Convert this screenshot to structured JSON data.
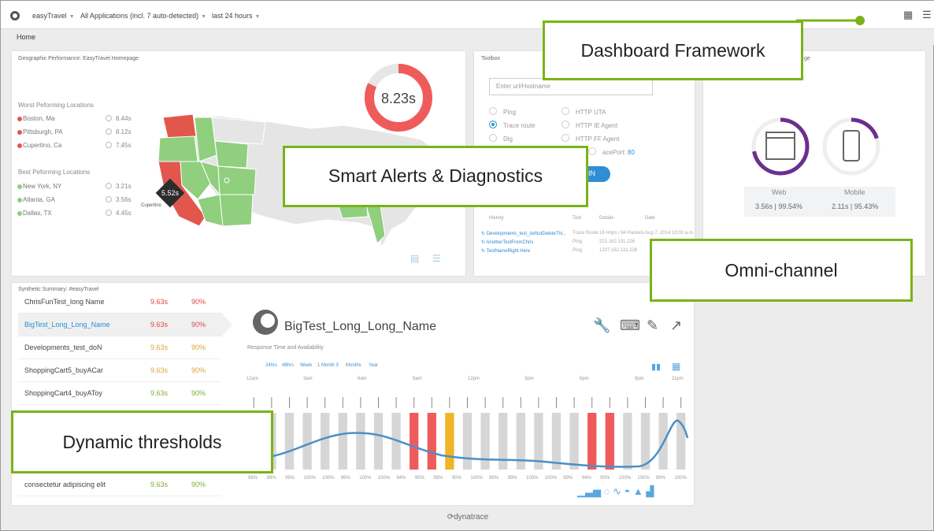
{
  "topbar": {
    "app": "easyTravel",
    "apps": "All Applications (incl. 7 auto-detected)",
    "time": "last 24 hours"
  },
  "breadcrumb": "Home",
  "geo": {
    "title": "Geographic Performance: EasyTravel Homepage",
    "score": "8.23s",
    "score_fraction": 0.82,
    "worst_heading": "Worst Peforming Locations",
    "worst": [
      {
        "name": "Boston, Ma",
        "time": "8.44s"
      },
      {
        "name": "Pittsburgh, PA",
        "time": "8.12s"
      },
      {
        "name": "Cupertino, Ca",
        "time": "7.45s"
      }
    ],
    "best_heading": "Best Peforming Locations",
    "best": [
      {
        "name": "New York, NY",
        "time": "3.21s"
      },
      {
        "name": "Atlanta, GA",
        "time": "3.56s"
      },
      {
        "name": "Dallas, TX",
        "time": "4.45s"
      }
    ],
    "tooltip_value": "5.52s",
    "tooltip_city": "Cupertino",
    "colors": {
      "bad": "#e2574c",
      "good": "#8fcf7e",
      "neutral": "#e5e5e5"
    }
  },
  "toolbox": {
    "title": "Toolbox",
    "url_placeholder": "Enter url/Hostname",
    "options": [
      "Ping",
      "Trace route",
      "Dig",
      "HTTP UTA",
      "HTTP IE Agent",
      "HTTP FF Agent"
    ],
    "selected": "Trace route",
    "port_label": "acePort:",
    "port_value": "80",
    "run_label": "IN",
    "history_headers": [
      "History",
      "Tool",
      "Details",
      "Date"
    ],
    "history": [
      {
        "name": "Developments_test_doNotDeleteThi...",
        "tool": "Trace Route",
        "details": "16 Hops / 64 Packets",
        "date": "Aug 7, 2014 10:00 a.m."
      },
      {
        "name": "AnotherTestFromChris",
        "tool": "Ping",
        "details": "221.162.131.226",
        "date": ""
      },
      {
        "name": "TestNameRight Here",
        "tool": "Ping",
        "details": "1207.162.131.226",
        "date": ""
      }
    ]
  },
  "channels": {
    "suffix": "ge",
    "web": {
      "label": "Web",
      "value": "3.56s | 99.54%",
      "fraction": 0.72
    },
    "mobile": {
      "label": "Mobile",
      "value": "2.11s | 95.43%",
      "fraction": 0.2
    }
  },
  "synthetic": {
    "title": "Synthetic Summary: #easyTravel",
    "rows": [
      {
        "name": "ChrisFunTest_long Name",
        "time": "9.63s",
        "avail": "90%",
        "status": "red"
      },
      {
        "name": "BigTest_Long_Long_Name",
        "time": "9.63s",
        "avail": "90%",
        "status": "red",
        "selected": true
      },
      {
        "name": "Developments_test_doN",
        "time": "9.63s",
        "avail": "90%",
        "status": "amber"
      },
      {
        "name": "ShoppingCart5_buyACar",
        "time": "9.63s",
        "avail": "90%",
        "status": "amber"
      },
      {
        "name": "ShoppingCart4_buyAToy",
        "time": "9.63s",
        "avail": "90%",
        "status": "green"
      },
      {
        "name": "consectetur adipiscing elit",
        "time": "9.63s",
        "avail": "90%",
        "status": "green"
      }
    ]
  },
  "detail": {
    "name": "BigTest_Long_Long_Name",
    "subtitle": "Response Time and Availability",
    "ranges": [
      "24hrs",
      "48hrs",
      "Week",
      "1 Month 3",
      "Months",
      "Year"
    ],
    "hours": [
      "12am",
      "3am",
      "6am",
      "9am",
      "12pm",
      "3pm",
      "6pm",
      "9pm",
      "11pm"
    ]
  },
  "chart_data": {
    "type": "bar",
    "bar_colors": {
      "normal": "#d6d6d6",
      "warning": "#f0b429",
      "critical": "#ef5b5b",
      "line": "#4a90c8"
    },
    "bars": [
      "n",
      "n",
      "n",
      "n",
      "n",
      "n",
      "n",
      "n",
      "n",
      "c",
      "c",
      "w",
      "n",
      "n",
      "n",
      "n",
      "n",
      "n",
      "n",
      "c",
      "c",
      "n",
      "n",
      "n",
      "n"
    ],
    "percent_labels": [
      "98%",
      "99%",
      "99%",
      "100%",
      "100%",
      "99%",
      "100%",
      "100%",
      "94%",
      "90%",
      "98%",
      "90%",
      "100%",
      "99%",
      "99%",
      "100%",
      "100%",
      "99%",
      "94%",
      "90%",
      "100%",
      "100%",
      "99%",
      "100%"
    ]
  },
  "annotations": {
    "framework": "Dashboard Framework",
    "alerts": "Smart Alerts & Diagnostics",
    "omni": "Omni-channel",
    "thresholds": "Dynamic thresholds"
  },
  "footer": "dynatrace"
}
